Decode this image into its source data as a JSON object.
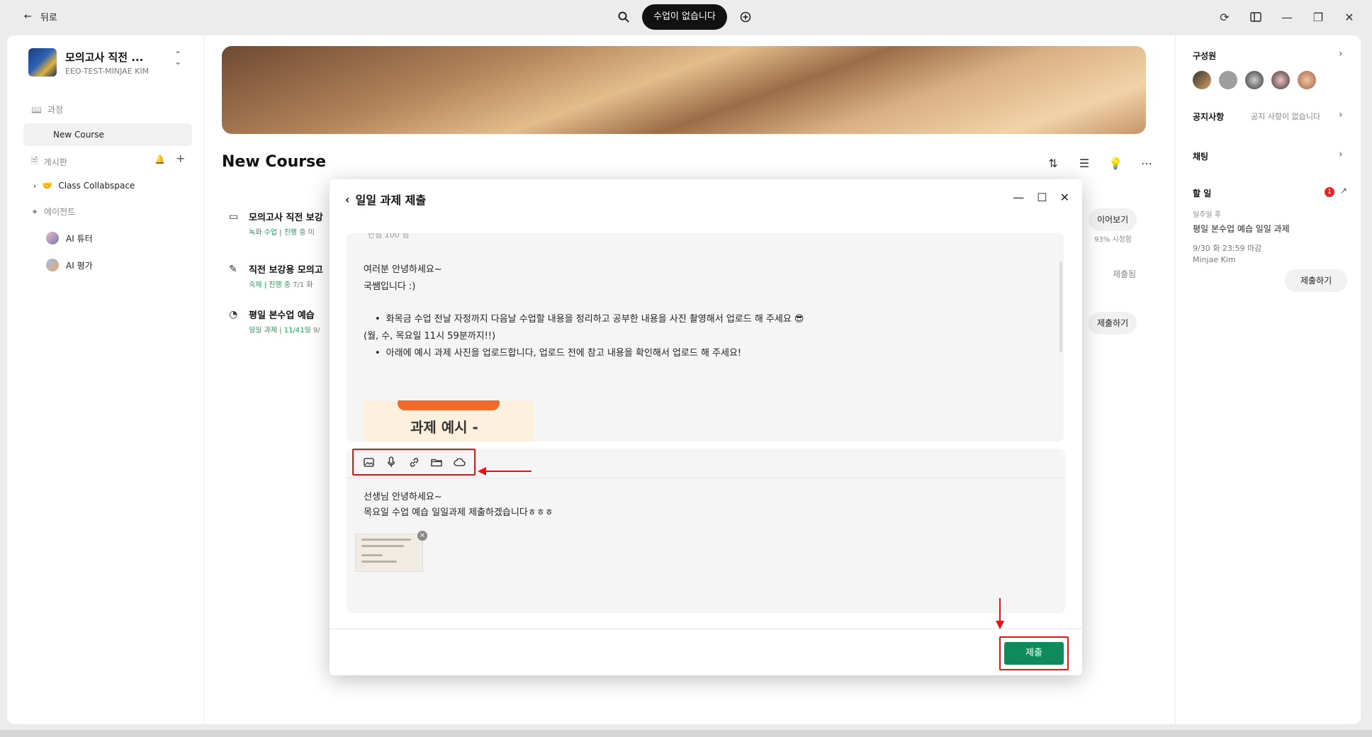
{
  "topbar": {
    "back_label": "뒤로",
    "status_pill": "수업이 없습니다"
  },
  "sidebar": {
    "course_title": "모의고사 직전 ...",
    "course_subtitle": "EEO-TEST-MINJAE KIM",
    "section_course": "과정",
    "item_new_course": "New Course",
    "section_board": "게시판",
    "item_collabspace": "Class Collabspace",
    "item_collabspace_emoji": "🤝",
    "section_agent": "에이전트",
    "item_ai_tutor": "AI 튜터",
    "item_ai_eval": "AI 평가"
  },
  "main": {
    "title": "New Course",
    "rows": [
      {
        "title": "모의고사 직전 보강",
        "tag": "녹화 수업 | 진행 중",
        "meta": "미",
        "action": "이어보기",
        "action_sub": "93% 시청함"
      },
      {
        "title": "직전 보강용 모의고",
        "tag": "숙제 | 진행 중",
        "meta": "7/1 화",
        "action": "제출됨",
        "action_sub": ""
      },
      {
        "title": "평일 본수업 예습",
        "tag": "일일 과제 | 11/41일",
        "meta": "9/",
        "action": "제출하기",
        "action_sub": ""
      }
    ]
  },
  "right_panel": {
    "members_title": "구성원",
    "notice_title": "공지사항",
    "notice_empty": "공지 사항이 없습니다",
    "chat_title": "채팅",
    "todo_title": "할 일",
    "todo_badge": "1",
    "todo_week": "일주일 후",
    "todo_item": "평일 본수업 예습 일일 과제",
    "todo_due": "9/30 화 23:59 마감",
    "todo_user": "Minjae Kim",
    "todo_button": "제출하기"
  },
  "modal": {
    "title": "일일 과제 제출",
    "content_top_cut": "만점 100 점",
    "greeting1": "여러분 안녕하세요~",
    "greeting2": "국쌤입니다 :)",
    "bullet1": "화목금 수업 전날 자정까지 다음날 수업할 내용을 정리하고 공부한 내용을 사진 촬영해서 업로드 해 주세요 😎",
    "bullet1_sub": "(월, 수, 목요일 11시 59분까지!!)",
    "bullet2": "아래에 예시 과제 사진을 업로드합니다, 업로드 전에 참고 내용을 확인해서 업로드 해 주세요!",
    "example_label": "과제 예시 -",
    "editor_line1": "선생님 안녕하세요~",
    "editor_line2": "목요일 수업 예습 일일과제 제출하겠습니다ㅎㅎㅎ",
    "submit_label": "제출"
  }
}
